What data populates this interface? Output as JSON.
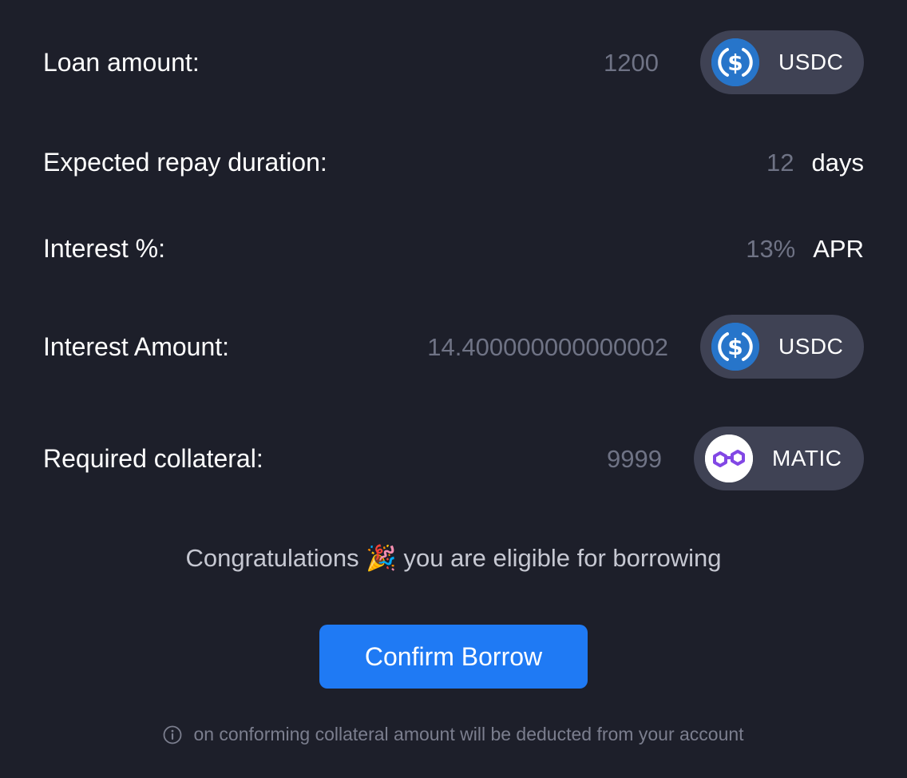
{
  "loan": {
    "label": "Loan amount:",
    "value": "1200",
    "token": "USDC",
    "token_icon": "usdc-icon"
  },
  "duration": {
    "label": "Expected repay duration:",
    "value": "12",
    "unit": "days"
  },
  "interest_rate": {
    "label": "Interest %:",
    "value": "13%",
    "unit": "APR"
  },
  "interest_amount": {
    "label": "Interest Amount:",
    "value": "14.400000000000002",
    "token": "USDC",
    "token_icon": "usdc-icon"
  },
  "collateral": {
    "label": "Required collateral:",
    "value": "9999",
    "token": "MATIC",
    "token_icon": "matic-icon"
  },
  "message": {
    "before": "Congratulations",
    "emoji": "🎉",
    "after": "you are eligible for borrowing"
  },
  "confirm_button": {
    "label": "Confirm Borrow"
  },
  "note": {
    "icon": "info-icon",
    "text": "on conforming collateral amount will be deducted from your account"
  },
  "colors": {
    "background": "#1d1f2a",
    "pill": "#3f4254",
    "accent": "#1f7af4",
    "usdc": "#2775ca",
    "matic": "#8247e5"
  }
}
